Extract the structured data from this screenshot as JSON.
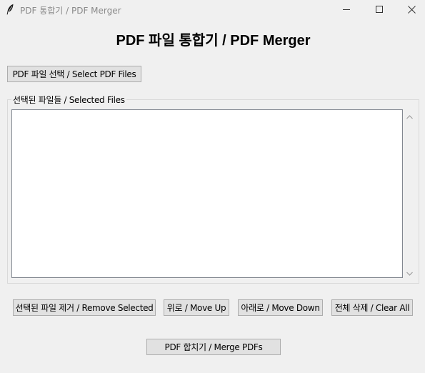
{
  "window": {
    "title": "PDF 통합기 / PDF Merger",
    "icon": "feather-icon",
    "controls": [
      "minimize-icon",
      "maximize-icon",
      "close-icon"
    ]
  },
  "heading": "PDF 파일 통합기 / PDF Merger",
  "select_button": "PDF 파일 선택 / Select PDF Files",
  "file_list": {
    "label": "선택된 파일들 / Selected Files",
    "items": []
  },
  "actions": {
    "remove": "선택된 파일 제거 / Remove Selected",
    "move_up": "위로 / Move Up",
    "move_down": "아래로 / Move Down",
    "clear_all": "전체 삭제 / Clear All"
  },
  "merge_button": "PDF 합치기 / Merge PDFs"
}
